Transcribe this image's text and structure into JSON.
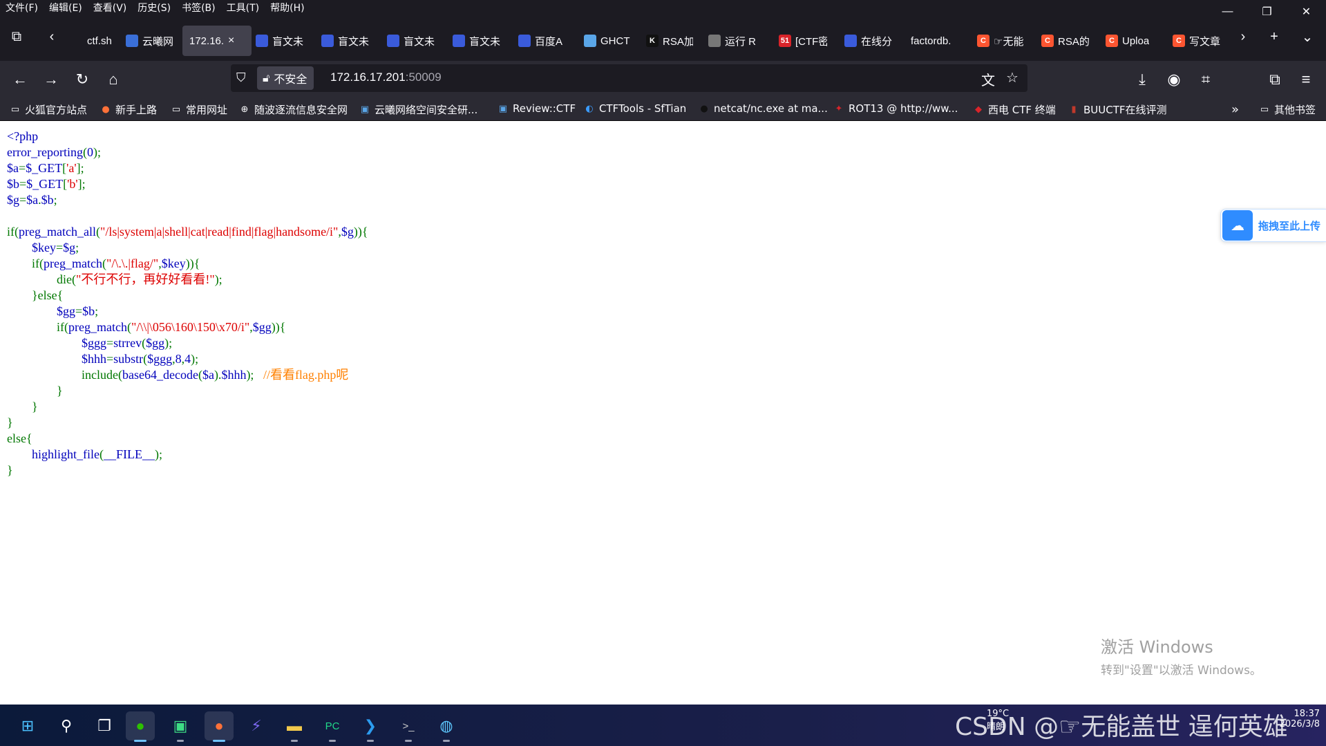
{
  "menu": [
    "文件(F)",
    "编辑(E)",
    "查看(V)",
    "历史(S)",
    "书签(B)",
    "工具(T)",
    "帮助(H)"
  ],
  "window_controls": {
    "minimize": "—",
    "restore": "❐",
    "close": "✕"
  },
  "tabs": [
    {
      "title": "ctf.sh",
      "icon": "document-icon",
      "color": "#1c1b22",
      "active": false
    },
    {
      "title": "云曦网",
      "icon": "site-icon",
      "color": "#3a6fd8",
      "active": false
    },
    {
      "title": "172.16.",
      "icon": "",
      "color": "",
      "active": true
    },
    {
      "title": "盲文未",
      "icon": "baidu-paw-icon",
      "color": "#3a5bdb",
      "active": false
    },
    {
      "title": "盲文未",
      "icon": "baidu-paw-icon",
      "color": "#3a5bdb",
      "active": false
    },
    {
      "title": "盲文未",
      "icon": "baidu-paw-icon",
      "color": "#3a5bdb",
      "active": false
    },
    {
      "title": "盲文未",
      "icon": "baidu-paw-icon",
      "color": "#3a5bdb",
      "active": false
    },
    {
      "title": "百度A",
      "icon": "baidu-paw-icon",
      "color": "#3a5bdb",
      "active": false
    },
    {
      "title": "GHCT",
      "icon": "globe-icon",
      "color": "#5aa6e8",
      "active": false
    },
    {
      "title": "RSA加",
      "icon": "k-logo-icon",
      "color": "#111111",
      "active": false
    },
    {
      "title": "运行 R",
      "icon": "avatar-icon",
      "color": "#777777",
      "active": false
    },
    {
      "title": "[CTF密",
      "icon": "51-logo-icon",
      "color": "#d9242a",
      "active": false
    },
    {
      "title": "在线分",
      "icon": "baidu-paw-icon",
      "color": "#3a5bdb",
      "active": false
    },
    {
      "title": "factordb.",
      "icon": "",
      "color": "",
      "active": false
    },
    {
      "title": "☞无能",
      "icon": "csdn-c-icon",
      "color": "#fc5531",
      "active": false
    },
    {
      "title": "RSA的",
      "icon": "csdn-c-icon",
      "color": "#fc5531",
      "active": false
    },
    {
      "title": "Uploa",
      "icon": "csdn-c-icon",
      "color": "#fc5531",
      "active": false
    },
    {
      "title": "写文章",
      "icon": "csdn-c-icon",
      "color": "#fc5531",
      "active": false
    }
  ],
  "address": {
    "security_label": "不安全",
    "host": "172.16.17.201",
    "port": ":50009"
  },
  "bookmarks": [
    {
      "label": "火狐官方站点",
      "icon": "folder-icon"
    },
    {
      "label": "新手上路",
      "icon": "firefox-icon"
    },
    {
      "label": "常用网址",
      "icon": "folder-icon"
    },
    {
      "label": "随波逐流信息安全网",
      "icon": "globe-icon"
    },
    {
      "label": "云曦网络空间安全研...",
      "icon": "site-icon"
    },
    {
      "label": "Review::CTF",
      "icon": "site-icon"
    },
    {
      "label": "CTFTools - SfTian",
      "icon": "ctftools-icon"
    },
    {
      "label": "netcat/nc.exe at ma...",
      "icon": "github-icon"
    },
    {
      "label": "ROT13 @ http://ww...",
      "icon": "rot13-icon"
    },
    {
      "label": "西电 CTF 终端",
      "icon": "xidian-icon"
    },
    {
      "label": "BUUCTF在线评测",
      "icon": "buuctf-icon"
    }
  ],
  "other_bookmarks": "其他书签",
  "code_lines": [
    [
      [
        "def",
        "<?php"
      ]
    ],
    [
      [
        "def",
        "error_reporting"
      ],
      [
        "kw",
        "("
      ],
      [
        "def",
        "0"
      ],
      [
        "kw",
        ");"
      ]
    ],
    [
      [
        "def",
        "$a"
      ],
      [
        "kw",
        "="
      ],
      [
        "def",
        "$_GET"
      ],
      [
        "kw",
        "["
      ],
      [
        "str",
        "'a'"
      ],
      [
        "kw",
        "];"
      ]
    ],
    [
      [
        "def",
        "$b"
      ],
      [
        "kw",
        "="
      ],
      [
        "def",
        "$_GET"
      ],
      [
        "kw",
        "["
      ],
      [
        "str",
        "'b'"
      ],
      [
        "kw",
        "];"
      ]
    ],
    [
      [
        "def",
        "$g"
      ],
      [
        "kw",
        "="
      ],
      [
        "def",
        "$a"
      ],
      [
        "kw",
        "."
      ],
      [
        "def",
        "$b"
      ],
      [
        "kw",
        ";"
      ]
    ],
    [],
    [
      [
        "kw",
        "if("
      ],
      [
        "def",
        "preg_match_all"
      ],
      [
        "kw",
        "("
      ],
      [
        "str",
        "\"/ls|system|a|shell|cat|read|find|flag|handsome/i\""
      ],
      [
        "kw",
        ","
      ],
      [
        "def",
        "$g"
      ],
      [
        "kw",
        ")){"
      ]
    ],
    [
      [
        "def",
        "        $key"
      ],
      [
        "kw",
        "="
      ],
      [
        "def",
        "$g"
      ],
      [
        "kw",
        ";"
      ]
    ],
    [
      [
        "kw",
        "        if("
      ],
      [
        "def",
        "preg_match"
      ],
      [
        "kw",
        "("
      ],
      [
        "str",
        "\"/\\.\\.|flag/\""
      ],
      [
        "kw",
        ","
      ],
      [
        "def",
        "$key"
      ],
      [
        "kw",
        ")){"
      ]
    ],
    [
      [
        "kw",
        "                die("
      ],
      [
        "str",
        "\"不行不行，再好好看看!\""
      ],
      [
        "kw",
        ");"
      ]
    ],
    [
      [
        "kw",
        "        }else{"
      ]
    ],
    [
      [
        "def",
        "                $gg"
      ],
      [
        "kw",
        "="
      ],
      [
        "def",
        "$b"
      ],
      [
        "kw",
        ";"
      ]
    ],
    [
      [
        "kw",
        "                if("
      ],
      [
        "def",
        "preg_match"
      ],
      [
        "kw",
        "("
      ],
      [
        "str",
        "\"/\\\\|\\056\\160\\150\\x70/i\""
      ],
      [
        "kw",
        ","
      ],
      [
        "def",
        "$gg"
      ],
      [
        "kw",
        ")){"
      ]
    ],
    [
      [
        "def",
        "                        $ggg"
      ],
      [
        "kw",
        "="
      ],
      [
        "def",
        "strrev"
      ],
      [
        "kw",
        "("
      ],
      [
        "def",
        "$gg"
      ],
      [
        "kw",
        ");"
      ]
    ],
    [
      [
        "def",
        "                        $hhh"
      ],
      [
        "kw",
        "="
      ],
      [
        "def",
        "substr"
      ],
      [
        "kw",
        "("
      ],
      [
        "def",
        "$ggg"
      ],
      [
        "kw",
        ","
      ],
      [
        "def",
        "8"
      ],
      [
        "kw",
        ","
      ],
      [
        "def",
        "4"
      ],
      [
        "kw",
        ");"
      ]
    ],
    [
      [
        "kw",
        "                        include("
      ],
      [
        "def",
        "base64_decode"
      ],
      [
        "kw",
        "("
      ],
      [
        "def",
        "$a"
      ],
      [
        "kw",
        ")."
      ],
      [
        "def",
        "$hhh"
      ],
      [
        "kw",
        ");   "
      ],
      [
        "com",
        "//看看flag.php呢"
      ]
    ],
    [
      [
        "kw",
        "                }"
      ]
    ],
    [
      [
        "kw",
        "        }"
      ]
    ],
    [
      [
        "kw",
        "}"
      ]
    ],
    [
      [
        "kw",
        "else{"
      ]
    ],
    [
      [
        "def",
        "        highlight_file"
      ],
      [
        "kw",
        "("
      ],
      [
        "def",
        "__FILE__"
      ],
      [
        "kw",
        ");"
      ]
    ],
    [
      [
        "kw",
        "}"
      ]
    ]
  ],
  "upload_widget": {
    "label": "拖拽至此上传"
  },
  "watermark": {
    "line1": "激活 Windows",
    "line2": "转到\"设置\"以激活 Windows。"
  },
  "taskbar": {
    "apps": [
      {
        "name": "start-button",
        "glyph": "⊞",
        "color": "#4cc2ff"
      },
      {
        "name": "search-icon",
        "glyph": "⚲",
        "color": "#ffffff"
      },
      {
        "name": "task-view-icon",
        "glyph": "❐",
        "color": "#ffffff"
      },
      {
        "name": "wechat-icon",
        "glyph": "●",
        "color": "#2dc100"
      },
      {
        "name": "terminal-app-icon",
        "glyph": "▣",
        "color": "#3ddc84"
      },
      {
        "name": "firefox-icon",
        "glyph": "●",
        "color": "#ff7139"
      },
      {
        "name": "power-app-icon",
        "glyph": "⚡",
        "color": "#7b68ee"
      },
      {
        "name": "file-explorer-icon",
        "glyph": "▬",
        "color": "#f2c94c"
      },
      {
        "name": "pycharm-icon",
        "glyph": "PC",
        "color": "#21d789"
      },
      {
        "name": "vscode-icon",
        "glyph": "❯",
        "color": "#2c9cf0"
      },
      {
        "name": "cmd-icon",
        "glyph": ">_",
        "color": "#cccccc"
      },
      {
        "name": "paint-icon",
        "glyph": "◍",
        "color": "#5ec9ff"
      }
    ],
    "weather": {
      "temp": "19°C",
      "condition": "晴朗"
    },
    "clock": {
      "time": "18:37",
      "date": "2026/3/8"
    },
    "csdn_watermark": "CSDN @☞无能盖世 逞何英雄"
  }
}
